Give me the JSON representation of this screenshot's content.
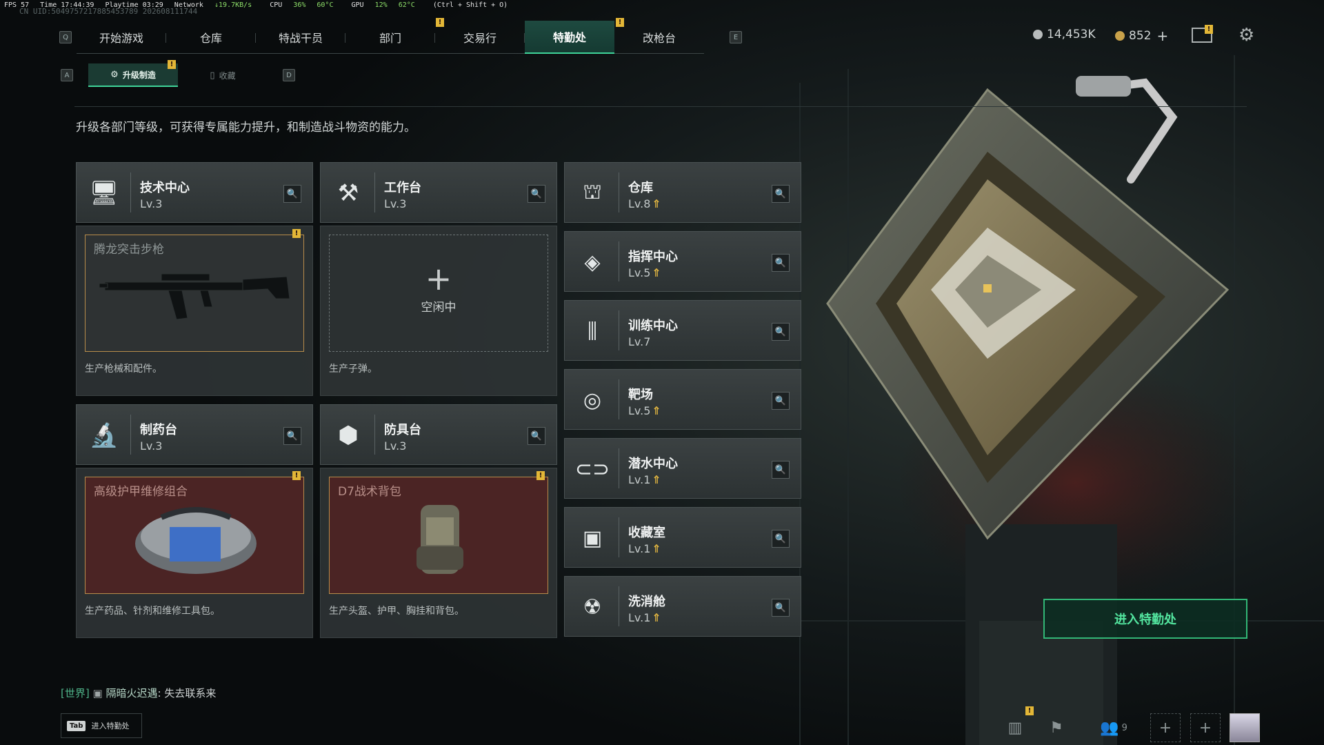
{
  "hud": {
    "fps": "FPS 57",
    "time": "Time 17:44:39",
    "playtime": "Playtime 03:29",
    "network_label": "Network",
    "network": "↓19.7KB/s",
    "cpu_label": "CPU",
    "cpu": "36%",
    "cpu_temp": "60°C",
    "gpu_label": "GPU",
    "gpu": "12%",
    "gpu_temp": "62°C",
    "shortcut": "(Ctrl + Shift + O)"
  },
  "uid": "CN UID:5049757217885453789 202608111744",
  "keys": {
    "left": "Q",
    "right": "E",
    "sub_left": "A",
    "sub_right": "D"
  },
  "top_tabs": [
    {
      "label": "开始游戏"
    },
    {
      "label": "仓库"
    },
    {
      "label": "特战干员"
    },
    {
      "label": "部门"
    },
    {
      "label": "交易行"
    },
    {
      "label": "特勤处"
    },
    {
      "label": "改枪台"
    }
  ],
  "alert": "!",
  "sub_tabs": [
    {
      "label": "升级制造",
      "icon": "⚙"
    },
    {
      "label": "收藏",
      "icon": "▯"
    }
  ],
  "currency": {
    "silver": "14,453K",
    "gold": "852",
    "gold_add": "+"
  },
  "description": "升级各部门等级，可获得专属能力提升，和制造战斗物资的能力。",
  "left_stations": [
    {
      "name": "技术中心",
      "level": "Lv.3",
      "product": "腾龙突击步枪",
      "footer": "生产枪械和配件。",
      "icon": "monitor-icon"
    },
    {
      "name": "工作台",
      "level": "Lv.3",
      "idle_label": "空闲中",
      "plus": "+",
      "footer": "生产子弹。",
      "icon": "tools-icon"
    },
    {
      "name": "制药台",
      "level": "Lv.3",
      "product": "高级护甲维修组合",
      "footer": "生产药品、针剂和维修工具包。",
      "icon": "microscope-icon"
    },
    {
      "name": "防具台",
      "level": "Lv.3",
      "product": "D7战术背包",
      "footer": "生产头盔、护甲、胸挂和背包。",
      "icon": "cubes-icon"
    }
  ],
  "right_stations": [
    {
      "name": "仓库",
      "level": "Lv.8",
      "upgradable": true,
      "icon": "warehouse-icon",
      "glyph": "⛫"
    },
    {
      "name": "指挥中心",
      "level": "Lv.5",
      "upgradable": true,
      "icon": "command-icon",
      "glyph": "◈"
    },
    {
      "name": "训练中心",
      "level": "Lv.7",
      "upgradable": false,
      "icon": "dumbbell-icon",
      "glyph": "⫼"
    },
    {
      "name": "靶场",
      "level": "Lv.5",
      "upgradable": true,
      "icon": "target-icon",
      "glyph": "◎"
    },
    {
      "name": "潜水中心",
      "level": "Lv.1",
      "upgradable": true,
      "icon": "diving-mask-icon",
      "glyph": "⊂⊃"
    },
    {
      "name": "收藏室",
      "level": "Lv.1",
      "upgradable": true,
      "icon": "collection-icon",
      "glyph": "▣"
    },
    {
      "name": "洗消舱",
      "level": "Lv.1",
      "upgradable": true,
      "icon": "decon-icon",
      "glyph": "☢"
    }
  ],
  "upgrade_glyph": "⇑",
  "enter_button": "进入特勤处",
  "chat": {
    "channel": "[世界]",
    "user": "隔暗火迟遇",
    "message": "失去联系来"
  },
  "tab_hint": {
    "key": "Tab",
    "label": "进入特勤处"
  },
  "friends_count": "9",
  "colors": {
    "accent": "#3fd59a",
    "alert": "#e3b737",
    "upgrade": "#e4b741",
    "panel": "#343a3b"
  }
}
